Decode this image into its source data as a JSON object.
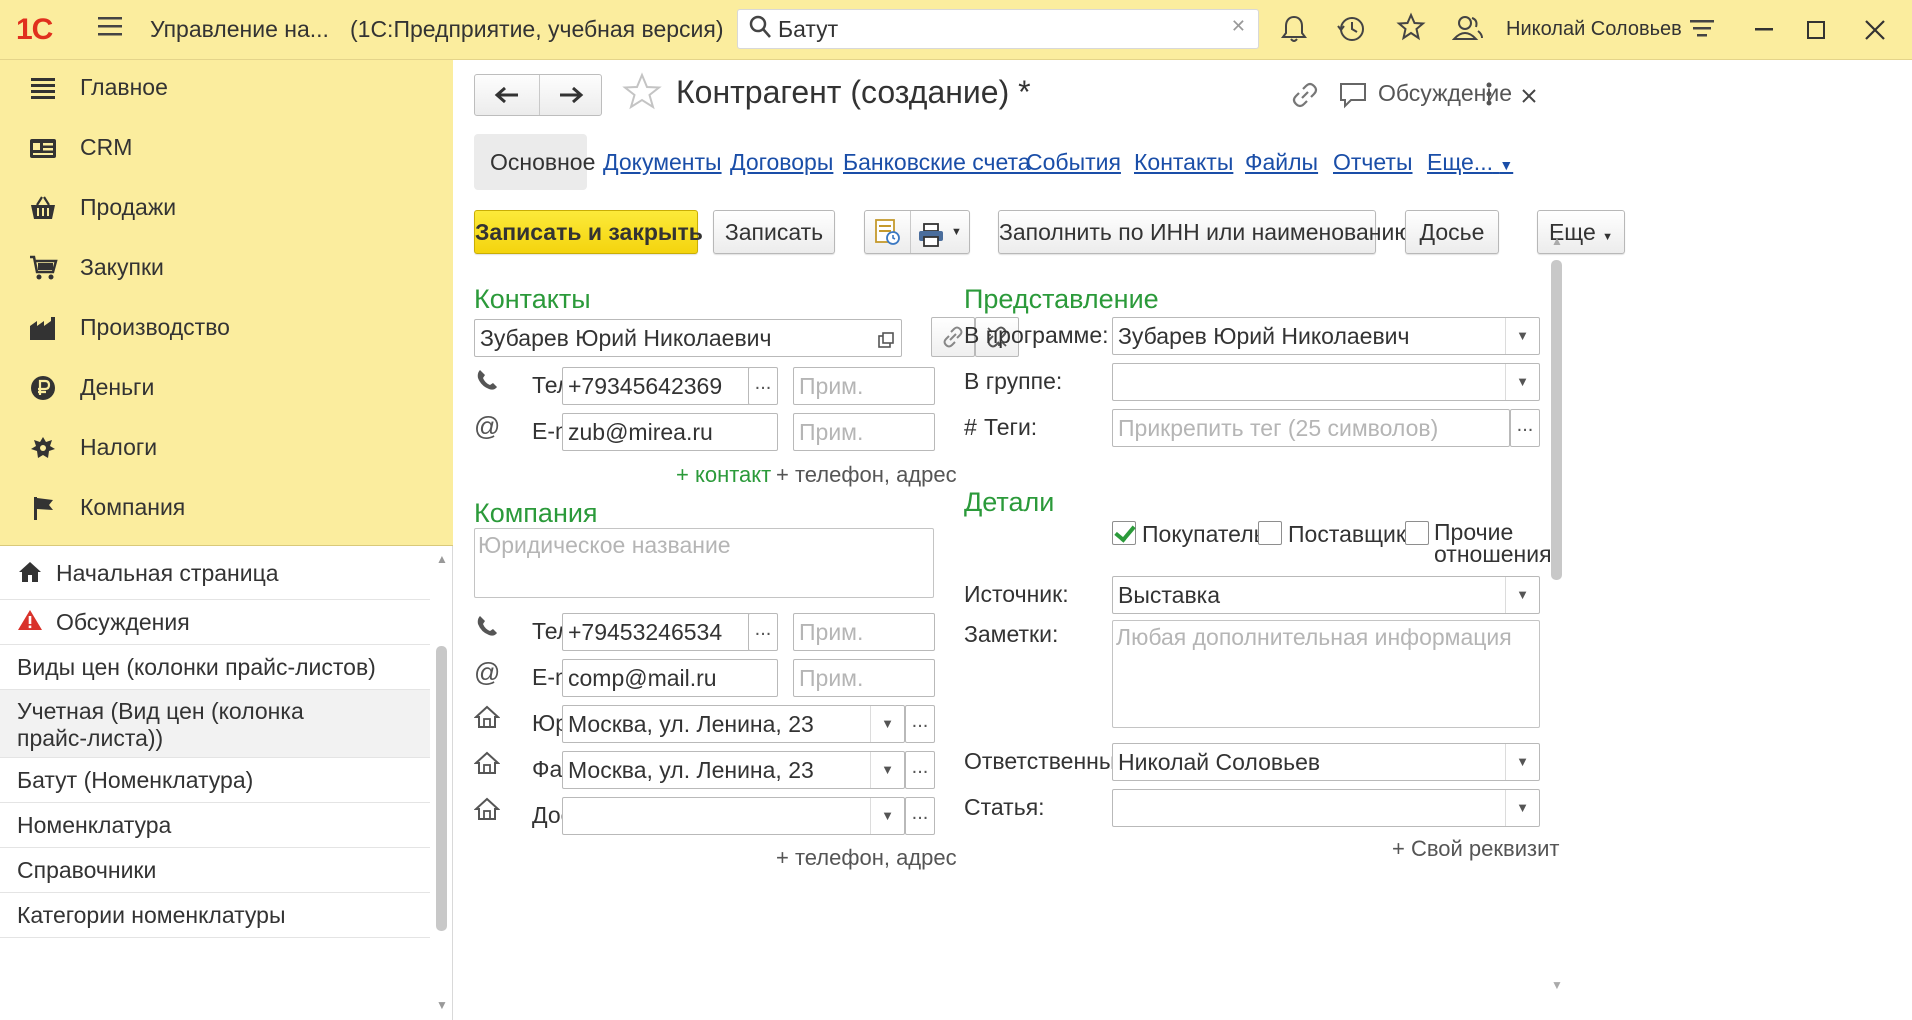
{
  "titlebar": {
    "logo": "1С",
    "app_title": "Управление на...",
    "app_subtitle": "(1С:Предприятие, учебная версия)",
    "search_value": "Батут",
    "user_name": "Николай Соловьев"
  },
  "sections": [
    {
      "label": "Главное",
      "icon": "menu-lines-icon"
    },
    {
      "label": "CRM",
      "icon": "crm-icon"
    },
    {
      "label": "Продажи",
      "icon": "basket-icon"
    },
    {
      "label": "Закупки",
      "icon": "cart-icon"
    },
    {
      "label": "Производство",
      "icon": "factory-icon"
    },
    {
      "label": "Деньги",
      "icon": "ruble-icon"
    },
    {
      "label": "Налоги",
      "icon": "emblem-icon"
    },
    {
      "label": "Компания",
      "icon": "flag-icon"
    }
  ],
  "open_windows": [
    {
      "label": "Начальная страница"
    },
    {
      "label": "Обсуждения"
    },
    {
      "label": "Виды цен (колонки прайс-листов)"
    },
    {
      "label": "Учетная (Вид цен (колонка",
      "label2": "прайс-листа))"
    },
    {
      "label": "Батут (Номенклатура)"
    },
    {
      "label": "Номенклатура"
    },
    {
      "label": "Справочники"
    },
    {
      "label": "Категории номенклатуры"
    }
  ],
  "form": {
    "title": "Контрагент (создание) *",
    "discussion": "Обсуждение",
    "tabs": [
      "Основное",
      "Документы",
      "Договоры",
      "Банковские счета",
      "События",
      "Контакты",
      "Файлы",
      "Отчеты",
      "Еще..."
    ],
    "toolbar": {
      "save_close": "Записать и закрыть",
      "save": "Записать",
      "fill_inn": "Заполнить по ИНН или наименованию",
      "dossier": "Досье",
      "more": "Еще"
    },
    "contacts": {
      "title": "Контакты",
      "person": "Зубарев Юрий Николаевич",
      "phone_label": "Телефон",
      "phone": "+79345642369",
      "email_label": "E-mail",
      "email": "zub@mirea.ru",
      "note_placeholder": "Прим.",
      "add_contact": "+ контакт",
      "add_phone_address": "+ телефон, адрес"
    },
    "company": {
      "title": "Компания",
      "legal_name_placeholder": "Юридическое название",
      "phone_label": "Телефон",
      "phone": "+79453246534",
      "email_label": "E-mail",
      "email": "comp@mail.ru",
      "note_placeholder": "Прим.",
      "legal_address_label": "Юр. адрес",
      "legal_address": "Москва, ул. Ленина, 23",
      "actual_address_label": "Факт. адрес",
      "actual_address": "Москва, ул. Ленина, 23",
      "delivery_label": "Доставка",
      "delivery": "",
      "add_phone_address": "+ телефон, адрес"
    },
    "presentation": {
      "title": "Представление",
      "in_program_label": "В программе:",
      "in_program": "Зубарев Юрий Николаевич",
      "in_group_label": "В группе:",
      "in_group": "",
      "tags_label": "Теги:",
      "tags_prefix": "#",
      "tags_placeholder": "Прикрепить тег (25 символов)"
    },
    "details": {
      "title": "Детали",
      "buyer": "Покупатель",
      "buyer_checked": true,
      "supplier": "Поставщик",
      "supplier_checked": false,
      "other": "Прочие",
      "other2": "отношения",
      "other_checked": false,
      "source_label": "Источник:",
      "source": "Выставка",
      "notes_label": "Заметки:",
      "notes_placeholder": "Любая дополнительная информация",
      "responsible_label": "Ответственный:",
      "responsible": "Николай Соловьев",
      "article_label": "Статья:",
      "article": "",
      "custom_attr": "+ Свой реквизит"
    }
  },
  "colors": {
    "titlebar_bg": "#fbed9e",
    "sections_bg": "#fbed9e",
    "group_title": "#2b9a3a",
    "link": "#1a4ea8",
    "primary_button": "#f4d40e",
    "logo": "#e0301e"
  }
}
